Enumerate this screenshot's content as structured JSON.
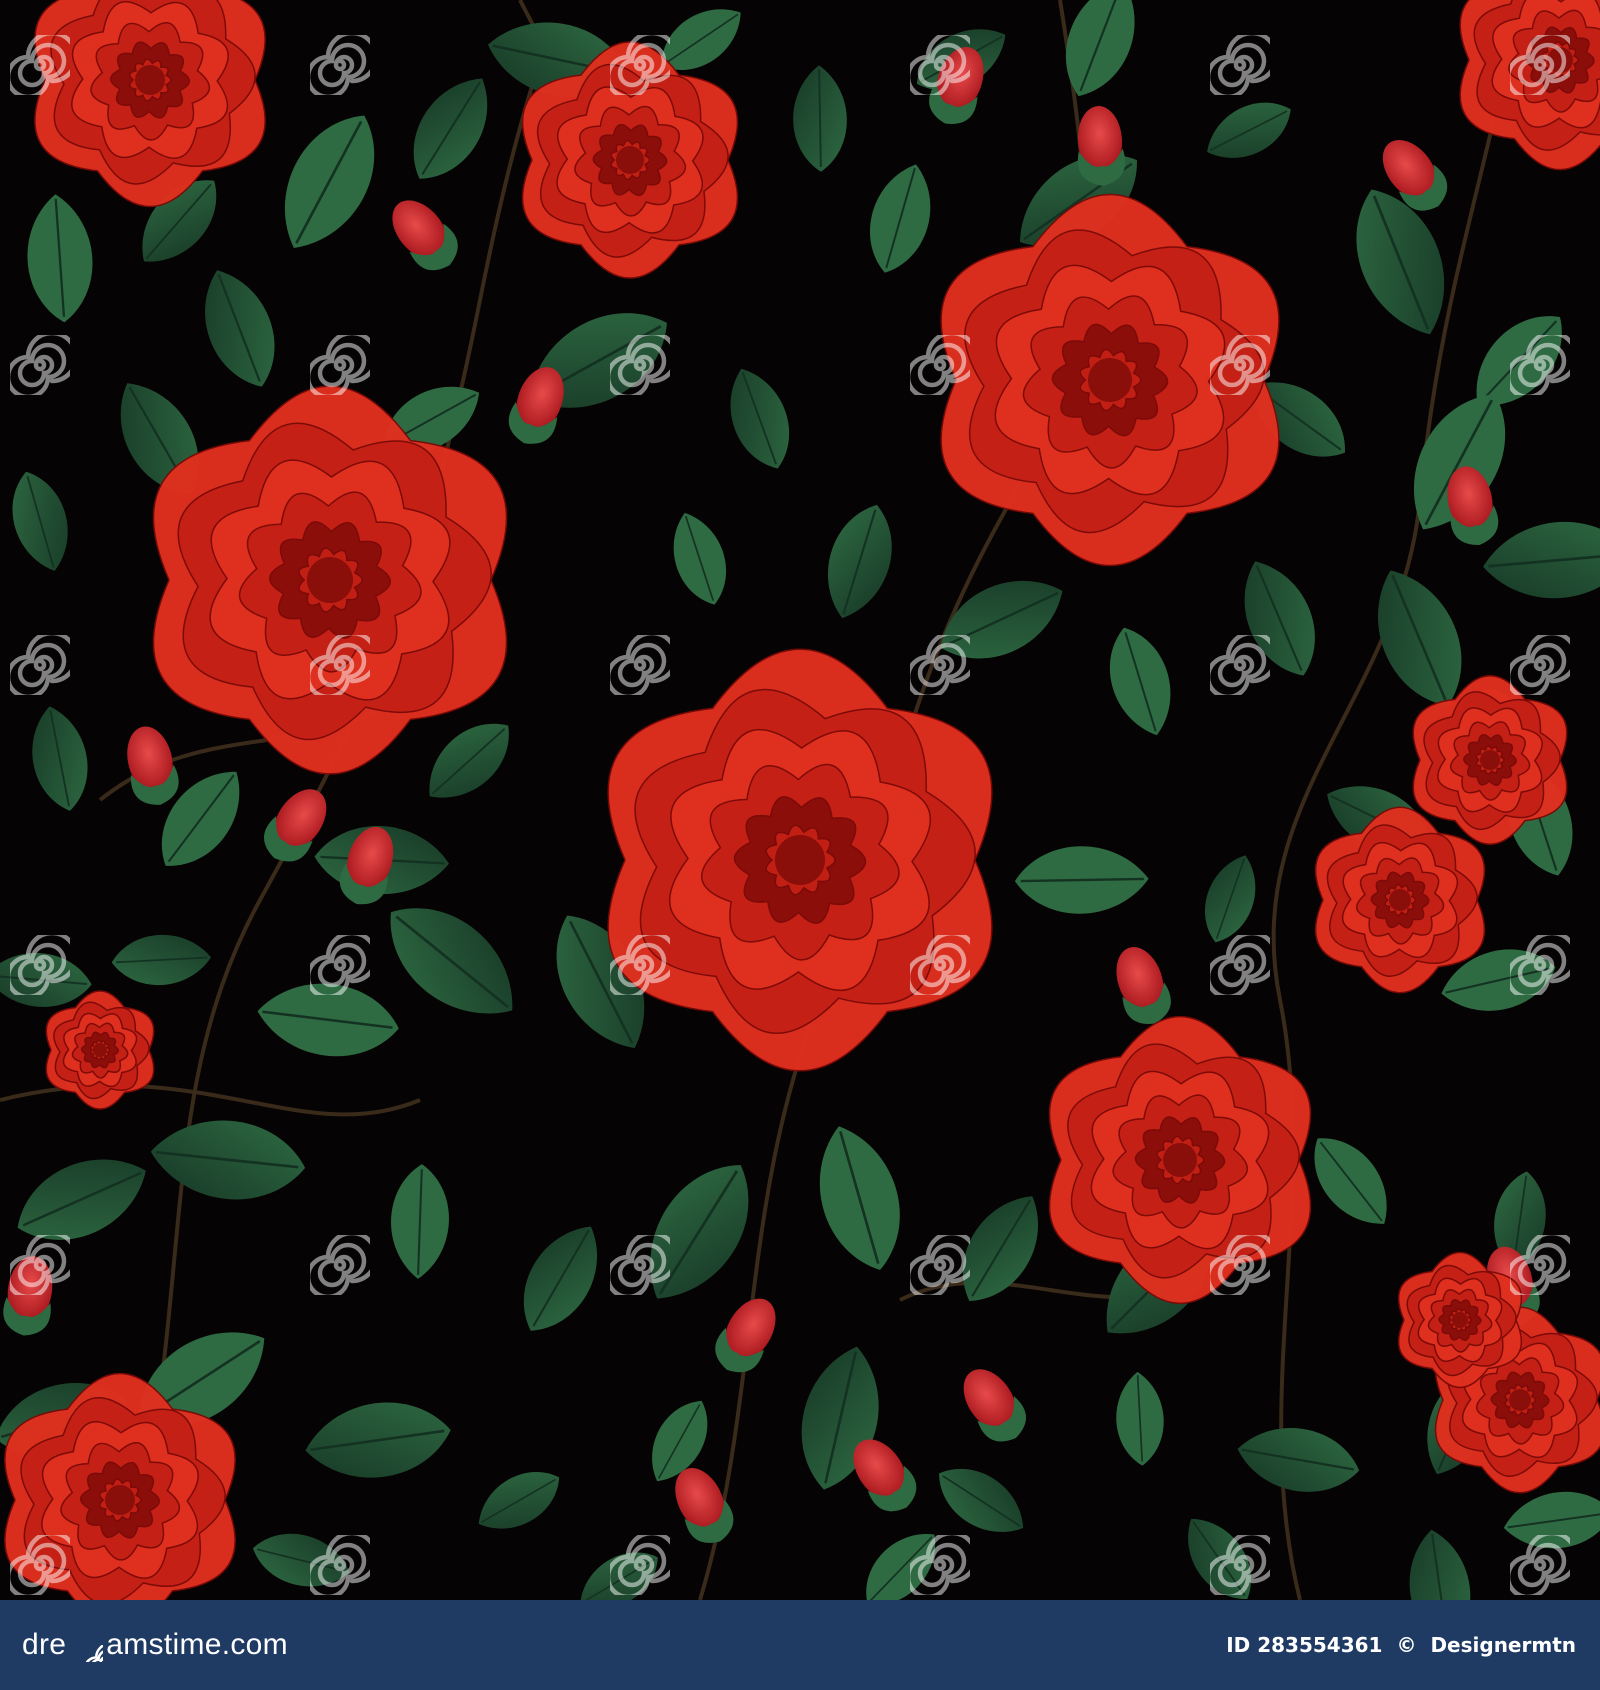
{
  "artwork": {
    "subject": "seamless pattern of red roses with green leaves on black background",
    "watermark_text": "dreamstime",
    "colors": {
      "background": "#050303",
      "rose_light": "#e0301f",
      "rose_mid": "#c42015",
      "rose_dark": "#8a0e0a",
      "leaf": "#1f4a30",
      "leaf_light": "#2e6a42",
      "watermark": "#ffffff"
    }
  },
  "footer": {
    "brand_prefix": "dre",
    "brand_suffix": "amstime.com",
    "brand_icon": "swirl-icon",
    "image_id": "ID 283554361",
    "copyright": "©",
    "author": "Designermtn",
    "background": "#1f3a63"
  }
}
